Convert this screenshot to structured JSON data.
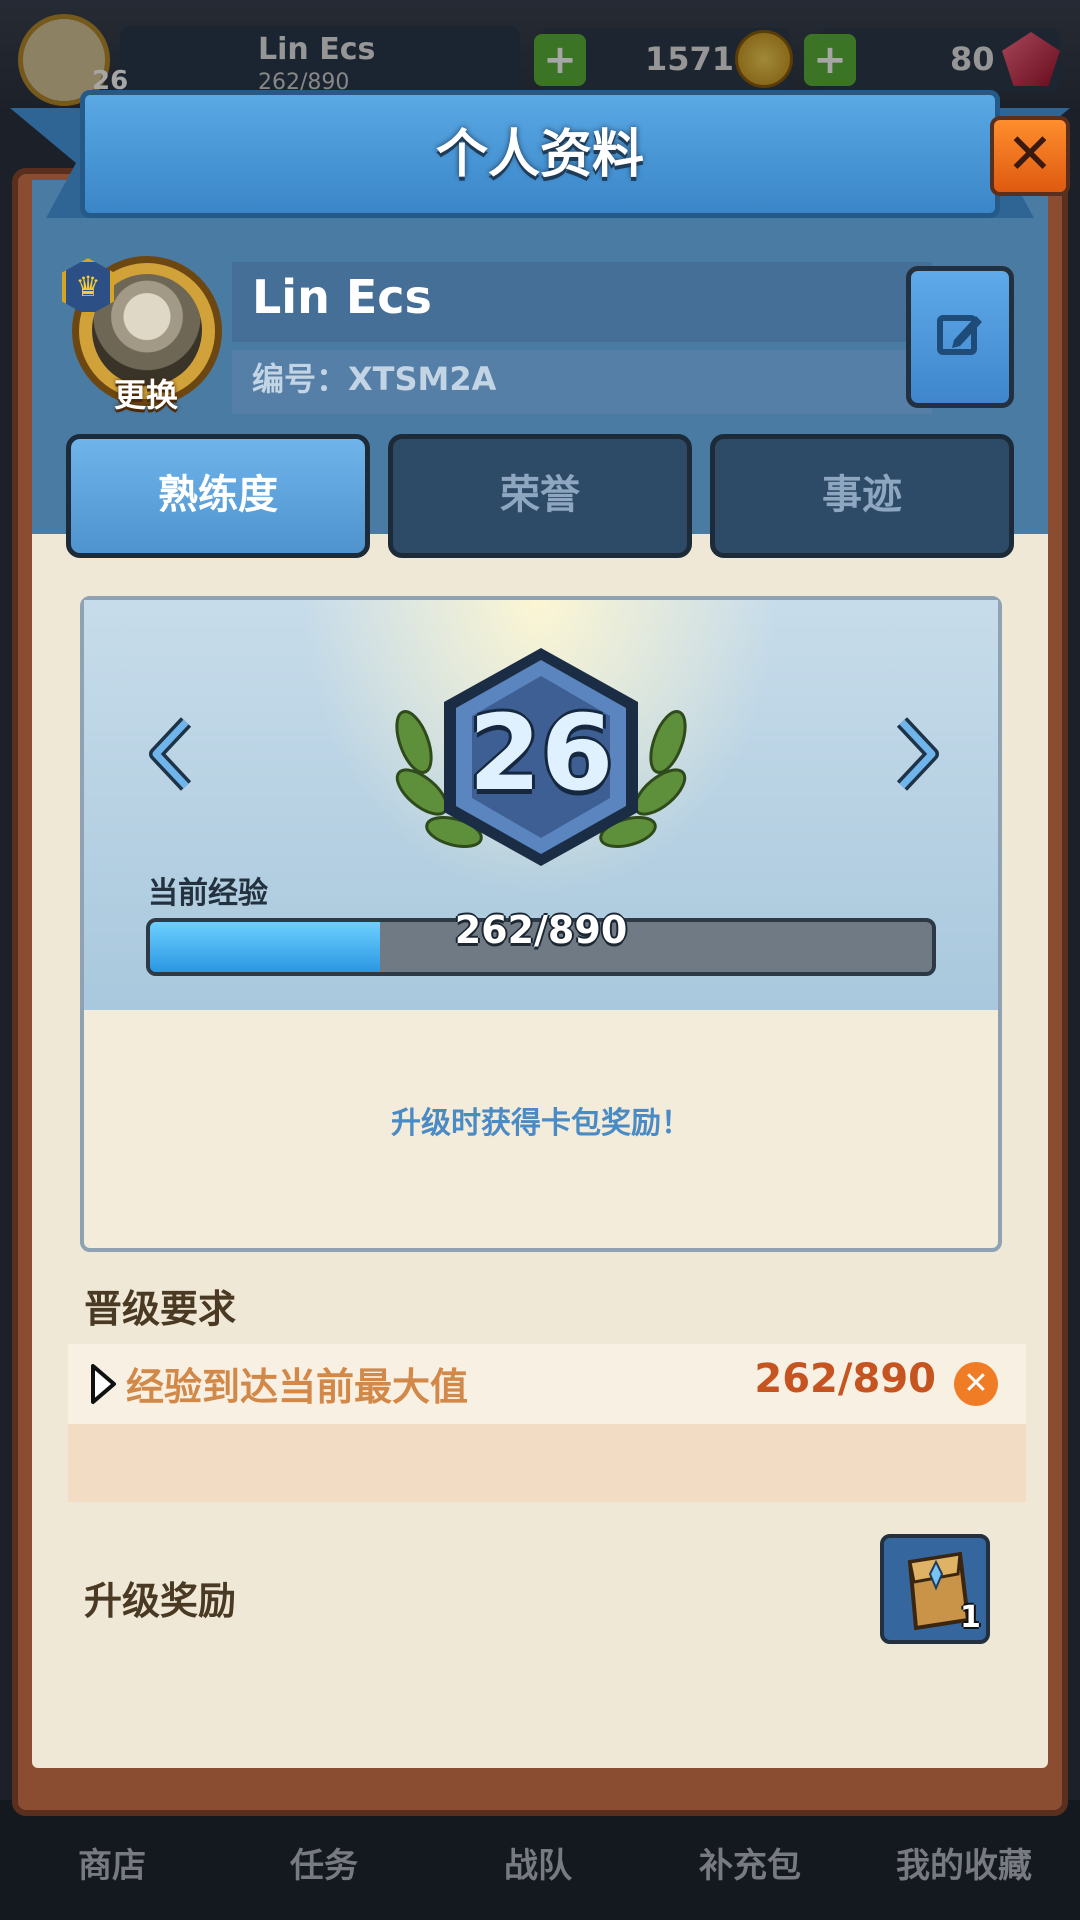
{
  "hud": {
    "player_name": "Lin Ecs",
    "level": "26",
    "exp": "262/890",
    "coins": "1571",
    "gems": "80"
  },
  "bottom_nav": [
    {
      "label": "商店"
    },
    {
      "label": "任务"
    },
    {
      "label": "战队"
    },
    {
      "label": "补充包"
    },
    {
      "label": "我的收藏"
    }
  ],
  "dialog": {
    "title": "个人资料",
    "close_icon": "close-icon"
  },
  "profile": {
    "name": "Lin Ecs",
    "id_text": "编号：XTSM2A",
    "change_avatar_label": "更换",
    "crown_icon": "crown-icon",
    "edit_icon": "edit-icon"
  },
  "tabs": [
    {
      "label": "熟练度",
      "active": true
    },
    {
      "label": "荣誉",
      "active": false
    },
    {
      "label": "事迹",
      "active": false
    }
  ],
  "level_card": {
    "level": "26",
    "exp_label": "当前经验",
    "exp_text": "262/890",
    "exp_current": 262,
    "exp_max": 890,
    "reward_tip": "升级时获得卡包奖励！"
  },
  "requirements": {
    "title": "晋级要求",
    "items": [
      {
        "text": "经验到达当前最大值",
        "value": "262/890",
        "status": "incomplete"
      }
    ]
  },
  "rewards": {
    "title": "升级奖励",
    "items": [
      {
        "icon": "card-pack-icon",
        "count": "1"
      }
    ]
  },
  "colors": {
    "accent_blue": "#4f93cf",
    "frame_brown": "#8b4d32",
    "exp_fill": "#2a97e3",
    "warning_orange": "#f07c26"
  }
}
